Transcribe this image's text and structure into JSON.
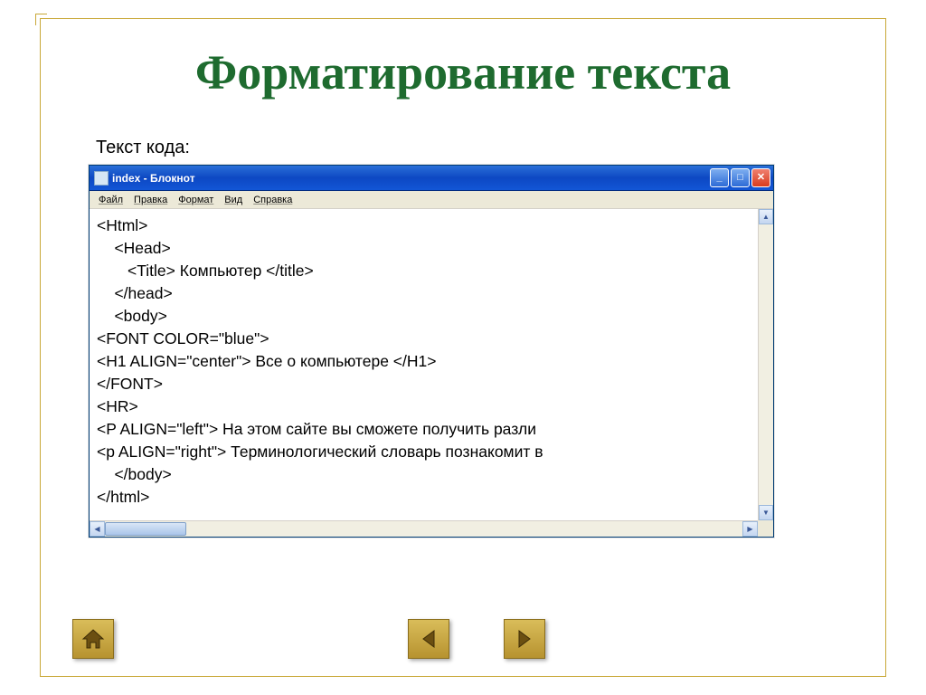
{
  "slide": {
    "title": "Форматирование текста",
    "subheading": "Текст кода:"
  },
  "window": {
    "title": "index - Блокнот",
    "menu": {
      "file": "Файл",
      "edit": "Правка",
      "format": "Формат",
      "view": "Вид",
      "help": "Справка"
    },
    "code": "<Html>\n    <Head>\n       <Title> Компьютер </title>\n    </head>\n    <body>\n<FONT COLOR=\"blue\">\n<H1 ALIGN=\"center\"> Все о компьютере </H1>\n</FONT>\n<HR>\n<P ALIGN=\"left\"> На этом сайте вы сможете получить разли\n<p ALIGN=\"right\"> Терминологический словарь познакомит в\n    </body>\n</html>"
  },
  "nav": {
    "home": "home-button",
    "prev": "prev-button",
    "next": "next-button"
  }
}
